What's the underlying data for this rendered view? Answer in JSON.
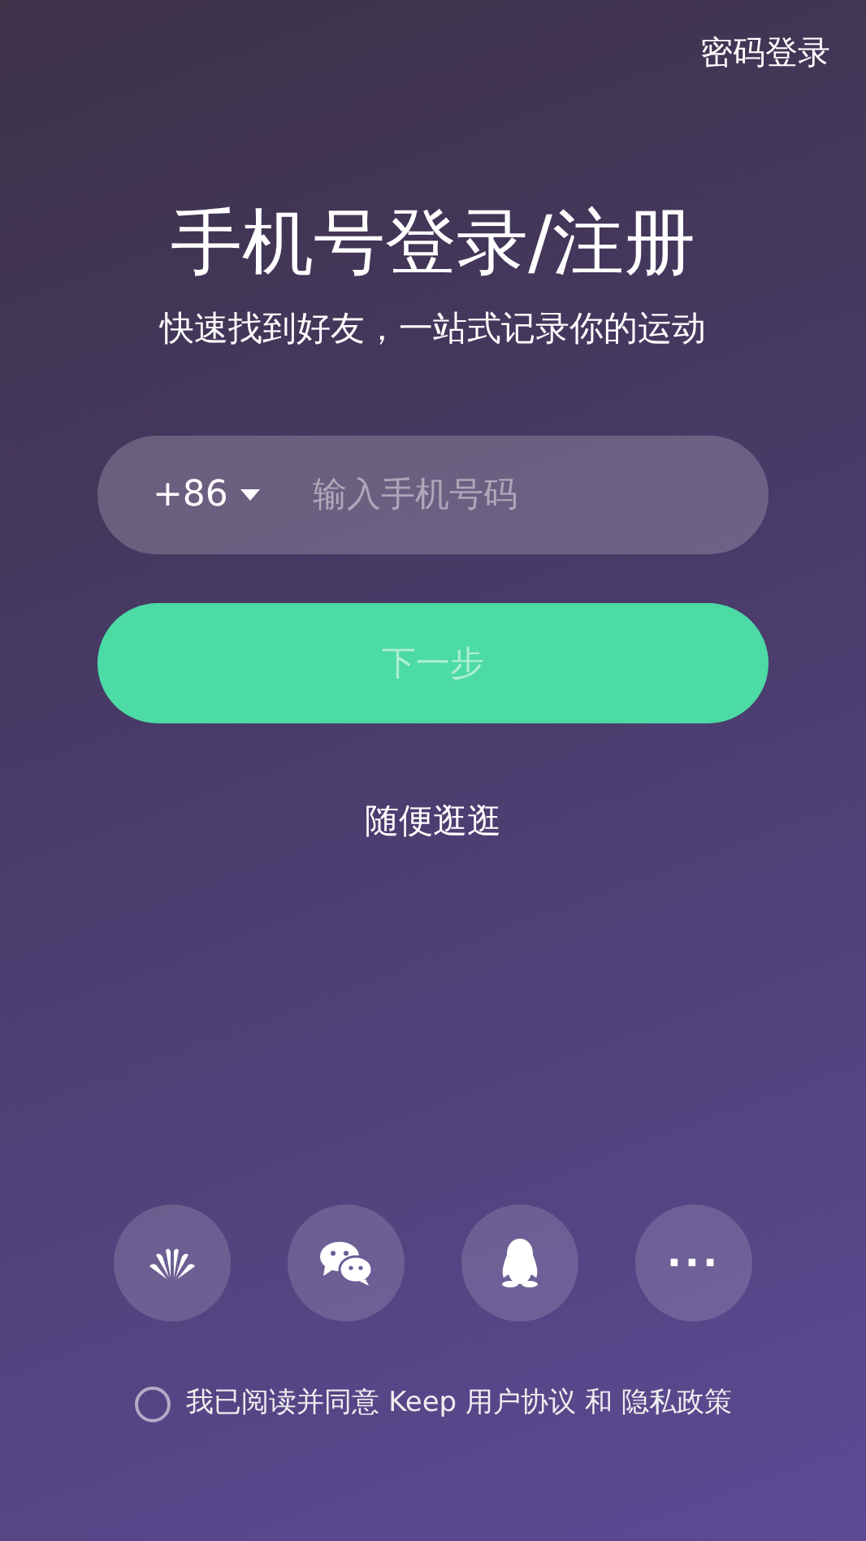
{
  "header": {
    "password_login": "密码登录"
  },
  "title": "手机号登录/注册",
  "subtitle": "快速找到好友，一站式记录你的运动",
  "phone": {
    "country_code": "+86",
    "placeholder": "输入手机号码"
  },
  "next_button": {
    "label": "下一步",
    "disabled": true
  },
  "browse_link": "随便逛逛",
  "social_logins": [
    {
      "kind": "huawei"
    },
    {
      "kind": "wechat"
    },
    {
      "kind": "qq"
    },
    {
      "kind": "more",
      "label": "···"
    }
  ],
  "agreement": {
    "checked": false,
    "text": "我已阅读并同意 Keep 用户协议 和 隐私政策"
  }
}
